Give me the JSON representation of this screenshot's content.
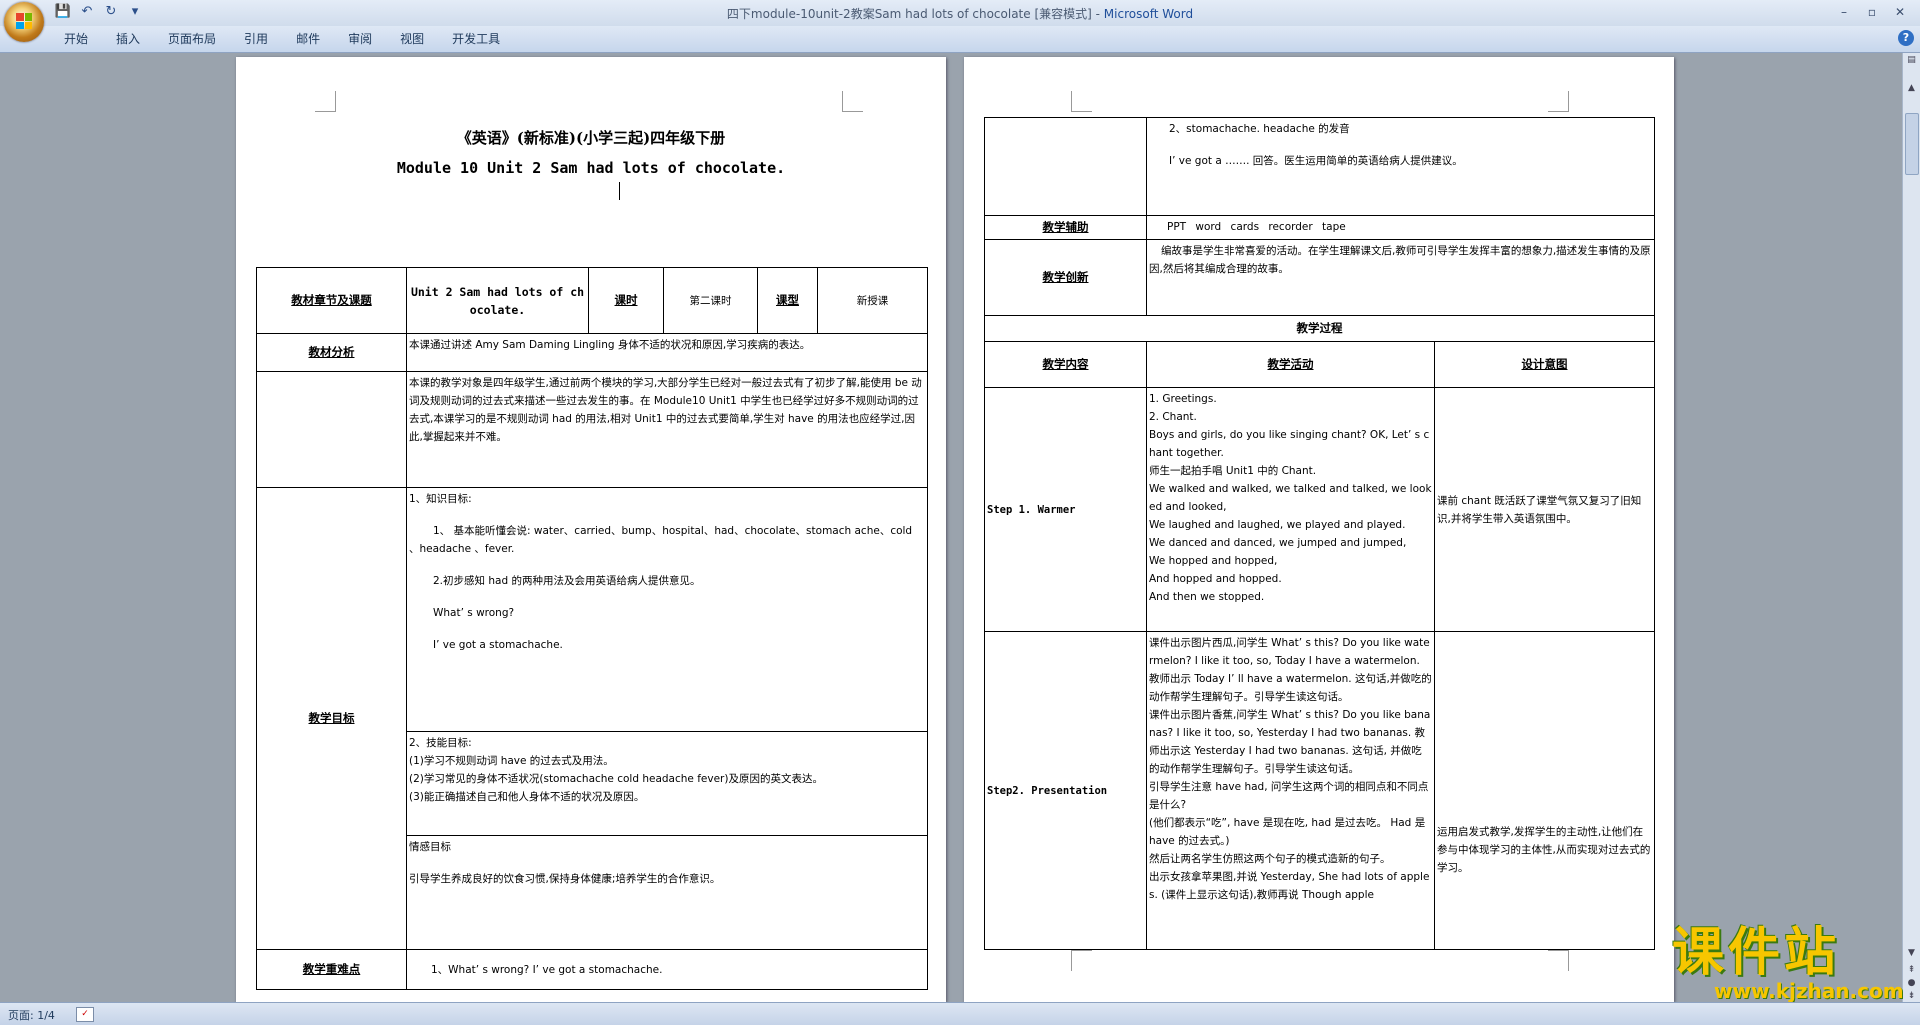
{
  "window": {
    "title": "四下module-10unit-2教案Sam had lots of chocolate [兼容模式] - ",
    "app_name": "Microsoft Word",
    "controls": {
      "minimize": "–",
      "restore": "▫",
      "close": "✕"
    }
  },
  "qat": {
    "save": "💾",
    "undo": "↶",
    "redo": "↻",
    "customize": "▾"
  },
  "ribbon": {
    "tabs": [
      "开始",
      "插入",
      "页面布局",
      "引用",
      "邮件",
      "审阅",
      "视图",
      "开发工具"
    ],
    "help": "?"
  },
  "status": {
    "page": "页面: 1/4"
  },
  "page1": {
    "title_line1": "《英语》(新标准)(小学三起)四年级下册",
    "title_line2": "Module 10 Unit 2 Sam had lots of chocolate.",
    "table": {
      "r1": {
        "label": "教材章节及课题",
        "lesson": "Unit 2 Sam had lots of chocolate.",
        "period_label": "课时",
        "period": "第二课时",
        "type_label": "课型",
        "type": "新授课"
      },
      "analysis_label": "教材分析",
      "analysis_text": "本课通过讲述 Amy Sam Daming Lingling 身体不适的状况和原因,学习疾病的表达。",
      "students_text": "本课的教学对象是四年级学生,通过前两个模块的学习,大部分学生已经对一般过去式有了初步了解,能使用 be 动词及规则动词的过去式来描述一些过去发生的事。在 Module10 Unit1 中学生也已经学过好多不规则动词的过去式,本课学习的是不规则动词 had 的用法,相对 Unit1 中的过去式要简单,学生对 have 的用法也应经学过,因此,掌握起来并不难。",
      "goals_label": "教学目标",
      "knowledge_title": "1、知识目标:",
      "knowledge_1": "1、 基本能听懂会说: water、carried、bump、hospital、had、chocolate、stomach ache、cold 、headache 、fever.",
      "knowledge_2": "2.初步感知 had 的两种用法及会用英语给病人提供意见。",
      "knowledge_3": "What’ s wrong?",
      "knowledge_4": "I’ ve got a stomachache.",
      "skills_title": "2、技能目标:",
      "skills_1": "(1)学习不规则动词 have 的过去式及用法。",
      "skills_2": "(2)学习常见的身体不适状况(stomachache cold headache fever)及原因的英文表达。",
      "skills_3": "(3)能正确描述自己和他人身体不适的状况及原因。",
      "emotion_title": "情感目标",
      "emotion_text": "引导学生养成良好的饮食习惯,保持身体健康;培养学生的合作意识。",
      "key_label": "教学重难点",
      "key_text": "1、What’ s wrong? I’ ve got a stomachache."
    }
  },
  "page2": {
    "top_1": "2、stomachache. headache 的发音",
    "top_2": "I’ ve got a ……. 回答。医生运用简单的英语给病人提供建议。",
    "aids_label": "教学辅助",
    "aids_text": "PPT word cards recorder tape",
    "innov_label": "教学创新",
    "innov_text": "编故事是学生非常喜爱的活动。在学生理解课文后,教师可引导学生发挥丰富的想象力,描述发生事情的及原因,然后将其编成合理的故事。",
    "process_label": "教学过程",
    "h_content": "教学内容",
    "h_activity": "教学活动",
    "h_intent": "设计意图",
    "step1_label": "Step 1. Warmer",
    "step1_lines": [
      "1. Greetings.",
      "2. Chant.",
      "Boys and girls, do you like singing chant? OK, Let’ s chant together.",
      "师生一起拍手唱 Unit1 中的 Chant.",
      "We walked and walked, we talked and talked, we looked and looked,",
      "We laughed and laughed, we played and played.",
      "We danced and danced, we jumped and jumped,",
      "We hopped and hopped,",
      "And hopped and hopped.",
      "And then we stopped."
    ],
    "step1_intent": "课前 chant 既活跃了课堂气氛又复习了旧知识,并将学生带入英语氛围中。",
    "step2_label": "Step2. Presentation",
    "step2_lines": [
      "课件出示图片西瓜,问学生 What’ s this? Do you like watermelon? I like it too, so, Today I have a watermelon. 教师出示 Today I’ ll have a watermelon. 这句话,并做吃的动作帮学生理解句子。引导学生读这句话。",
      "课件出示图片香蕉,问学生 What’ s this? Do you like bananas? I like it too, so, Yesterday I had two bananas. 教师出示这 Yesterday I had two bananas. 这句话, 并做吃的动作帮学生理解句子。引导学生读这句话。",
      "引导学生注意 have had, 问学生这两个词的相同点和不同点是什么?",
      "(他们都表示“吃”, have 是现在吃, had 是过去吃。 Had 是 have 的过去式。)",
      "然后让两名学生仿照这两个句子的模式造新的句子。",
      "出示女孩拿苹果图,并说 Yesterday, She had lots of apples. (课件上显示这句话),教师再说 Though apple"
    ],
    "step2_intent": "运用启发式教学,发挥学生的主动性,让他们在参与中体现学习的主体性,从而实现对过去式的学习。"
  },
  "watermark": {
    "brand": "课件站",
    "url": "www.kjzhan.com"
  }
}
